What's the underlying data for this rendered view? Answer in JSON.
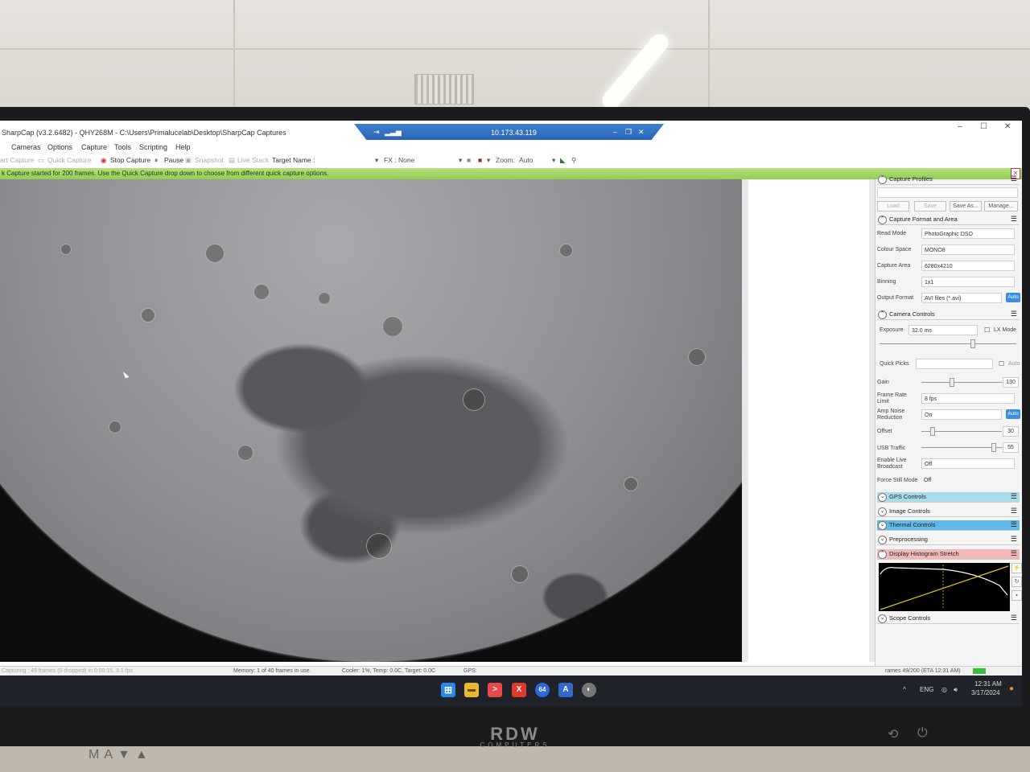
{
  "app": {
    "title": "SharpCap (v3.2.6482) - QHY268M - C:\\Users\\Primalucelab\\Desktop\\SharpCap Captures",
    "remote_ip": "10.173.43.119",
    "window_controls": {
      "minimize": "–",
      "maximize": "☐",
      "close": "✕"
    }
  },
  "menu": [
    "Cameras",
    "Options",
    "Capture",
    "Tools",
    "Scripting",
    "Help"
  ],
  "toolbar": {
    "start_capture": "art Capture",
    "quick_capture": "Quick Capture",
    "stop_capture": "Stop Capture",
    "pause": "Pause",
    "snapshot": "Snapshot",
    "live_stack": "Live Stack",
    "target_name": "Target Name :",
    "fx_label": "FX :",
    "fx_value": "None",
    "zoom_label": "Zoom:",
    "zoom_value": "Auto"
  },
  "notification": "k Capture started for 200 frames. Use the Quick Capture drop down to choose from different quick capture options.",
  "panel": {
    "capture_profiles": {
      "title": "Capture Profiles",
      "buttons": {
        "load": "Load",
        "save": "Save",
        "save_as": "Save As...",
        "manage": "Manage..."
      }
    },
    "capture_format": {
      "title": "Capture Format and Area",
      "read_mode_label": "Read Mode",
      "read_mode": "PhotoGraphic DSO",
      "colour_space_label": "Colour Space",
      "colour_space": "MONO8",
      "capture_area_label": "Capture Area",
      "capture_area": "6280x4210",
      "binning_label": "Binning",
      "binning": "1x1",
      "output_format_label": "Output Format",
      "output_format": "AVI files (*.avi)",
      "auto": "Auto"
    },
    "camera_controls": {
      "title": "Camera Controls",
      "exposure_label": "Exposure",
      "exposure": "32.0 ms",
      "lx_mode": "LX Mode",
      "quick_picks_label": "Quick Picks",
      "quick_picks_auto": "Auto",
      "gain_label": "Gain",
      "gain": "130",
      "frame_rate_label": "Frame Rate Limit",
      "frame_rate": "8 fps",
      "amp_noise_label": "Amp Noise Reduction",
      "amp_noise": "On",
      "amp_auto": "Auto",
      "offset_label": "Offset",
      "offset": "30",
      "usb_label": "USB Traffic",
      "usb": "55",
      "live_broadcast_label": "Enable Live Broadcast",
      "live_broadcast": "Off",
      "force_still_label": "Force Still Mode",
      "force_still": "Off"
    },
    "collapsed": {
      "gps": "GPS Controls",
      "image": "Image Controls",
      "thermal": "Thermal Controls",
      "preprocessing": "Preprocessing",
      "histogram": "Display Histogram Stretch",
      "scope": "Scope Controls"
    }
  },
  "status": {
    "capturing": "Capturing : 49 frames (0 dropped) in 0:00:15, 3.1 fps",
    "memory": "Memory: 1 of 40 frames in use.",
    "cooler": "Cooler: 1%, Temp: 0.0C, Target: 0.0C",
    "gps": "GPS:",
    "frames": "rames 49/200 (ETA 12:31 AM)"
  },
  "taskbar": {
    "lang": "ENG",
    "time": "12:31 AM",
    "date": "3/17/2024",
    "app64": "64"
  },
  "monitor": {
    "brand": "RDW",
    "brand_sub": "COMPUTERS",
    "model": "MA▼▲"
  },
  "colors": {
    "rdp_blue": "#2c66b4",
    "notify_green": "#9ad560",
    "gps_header": "#a9dce8",
    "thermal_header": "#5fb8e8",
    "histogram_header": "#f2b8b8",
    "auto_blue": "#3d8ee0"
  }
}
